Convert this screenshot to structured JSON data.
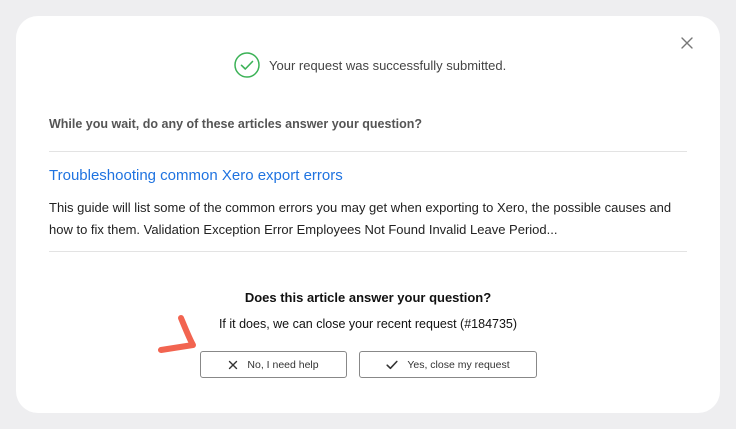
{
  "success": {
    "icon": "check-circle-icon",
    "text": "Your request was successfully submitted."
  },
  "prompt": "While you wait, do any of these articles answer your question?",
  "article": {
    "title": "Troubleshooting common Xero export errors",
    "excerpt": "This guide will list some of the common errors you may get when exporting to Xero, the possible causes and how to fix them. Validation Exception Error Employees Not Found Invalid Leave Period..."
  },
  "question": "Does this article answer your question?",
  "request_note": "If it does, we can close your recent request (#184735)",
  "buttons": {
    "no": {
      "label": "No, I need help",
      "icon": "x-icon"
    },
    "yes": {
      "label": "Yes, close my request",
      "icon": "checkmark-icon"
    }
  },
  "colors": {
    "success_green": "#3cb257",
    "link_blue": "#1f73e0",
    "annotation_arrow": "#f26450"
  }
}
